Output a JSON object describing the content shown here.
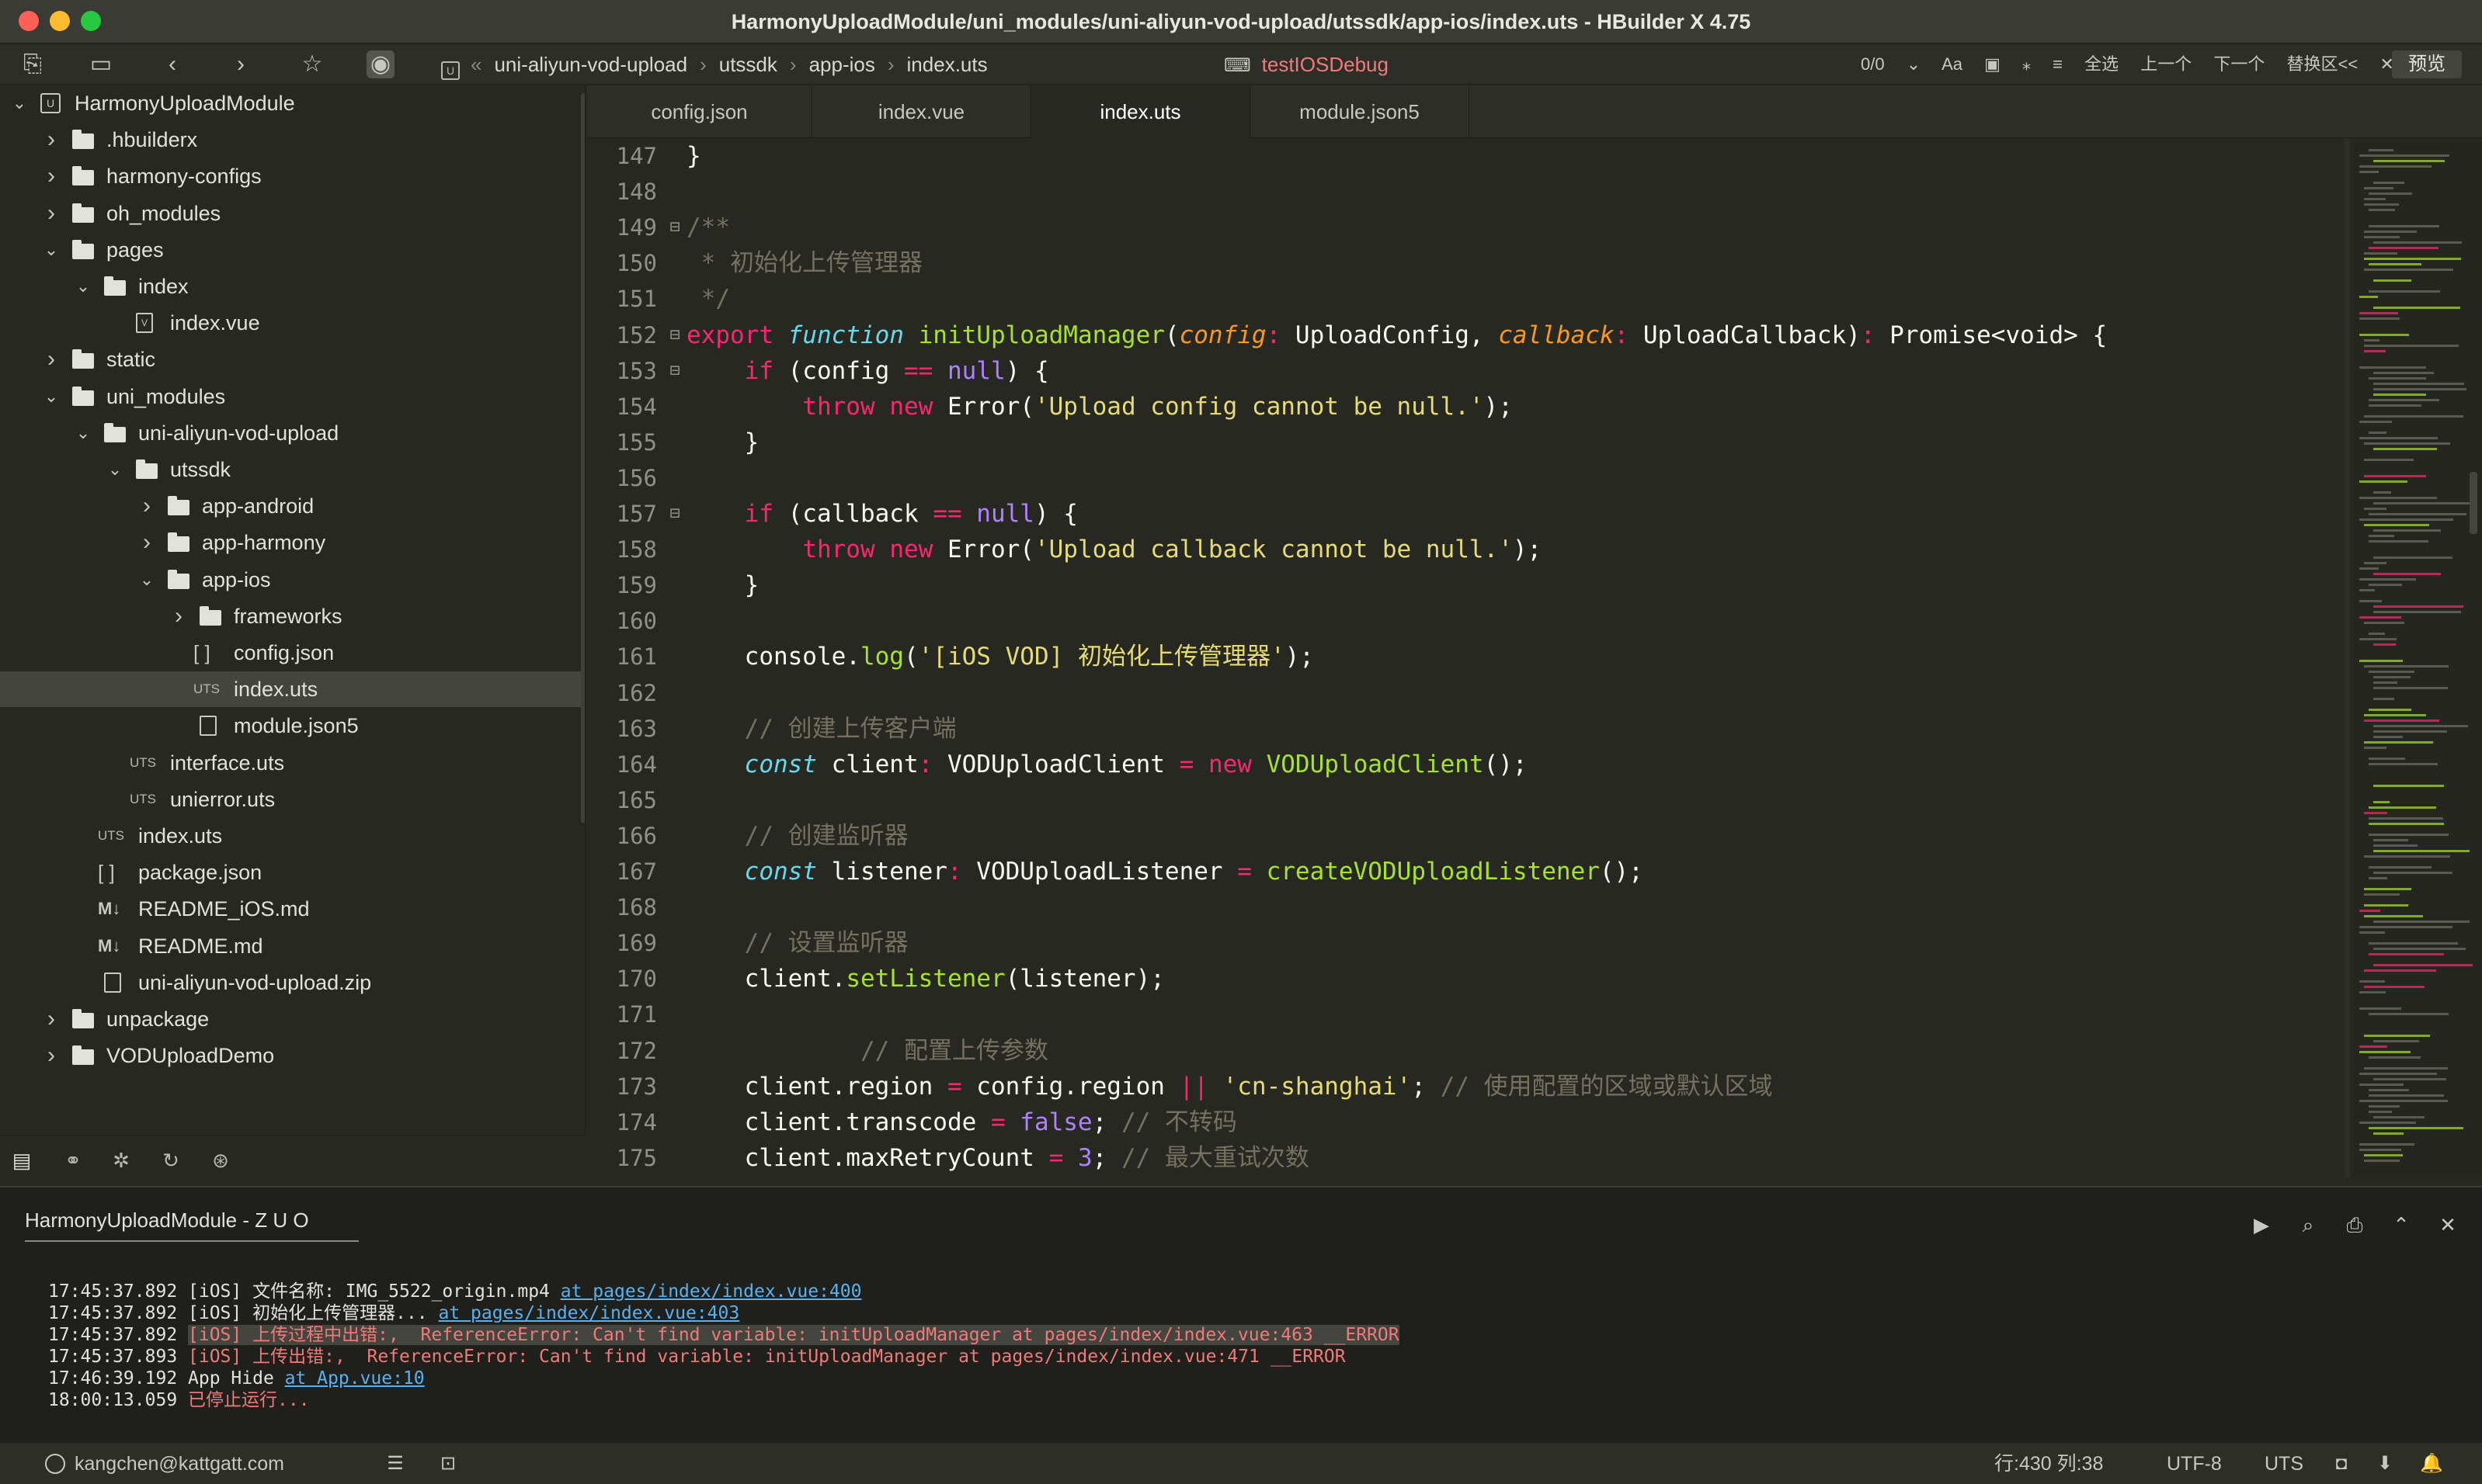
{
  "window": {
    "title": "HarmonyUploadModule/uni_modules/uni-aliyun-vod-upload/utssdk/app-ios/index.uts - HBuilder X 4.75"
  },
  "toolbar": {
    "breadcrumb": [
      "uni-aliyun-vod-upload",
      "utssdk",
      "app-ios",
      "index.uts"
    ],
    "run_config": "testIOSDebug",
    "find": {
      "count": "0/0",
      "case_label": "Aa",
      "select_all": "全选",
      "prev": "上一个",
      "next": "下一个",
      "replace": "替换区<<"
    },
    "preview_label": "预览"
  },
  "tree": [
    {
      "label": "HarmonyUploadModule",
      "type": "project",
      "expanded": true
    },
    {
      "label": ".hbuilderx",
      "type": "folder"
    },
    {
      "label": "harmony-configs",
      "type": "folder"
    },
    {
      "label": "oh_modules",
      "type": "folder"
    },
    {
      "label": "pages",
      "type": "folder",
      "expanded": true
    },
    {
      "label": "index",
      "type": "folder",
      "expanded": true
    },
    {
      "label": "index.vue",
      "type": "vue"
    },
    {
      "label": "static",
      "type": "folder"
    },
    {
      "label": "uni_modules",
      "type": "folder",
      "expanded": true
    },
    {
      "label": "uni-aliyun-vod-upload",
      "type": "folder",
      "expanded": true
    },
    {
      "label": "utssdk",
      "type": "folder",
      "expanded": true
    },
    {
      "label": "app-android",
      "type": "folder"
    },
    {
      "label": "app-harmony",
      "type": "folder"
    },
    {
      "label": "app-ios",
      "type": "folder",
      "expanded": true
    },
    {
      "label": "frameworks",
      "type": "folder"
    },
    {
      "label": "config.json",
      "type": "json"
    },
    {
      "label": "index.uts",
      "type": "uts",
      "selected": true
    },
    {
      "label": "module.json5",
      "type": "file"
    },
    {
      "label": "interface.uts",
      "type": "uts"
    },
    {
      "label": "unierror.uts",
      "type": "uts"
    },
    {
      "label": "index.uts",
      "type": "uts"
    },
    {
      "label": "package.json",
      "type": "json"
    },
    {
      "label": "README_iOS.md",
      "type": "md"
    },
    {
      "label": "README.md",
      "type": "md"
    },
    {
      "label": "uni-aliyun-vod-upload.zip",
      "type": "file"
    },
    {
      "label": "unpackage",
      "type": "folder"
    },
    {
      "label": "VODUploadDemo",
      "type": "folder"
    }
  ],
  "icon_labels": {
    "uts": "UTS",
    "json": "[ ]",
    "md": "M↓"
  },
  "tabs": [
    {
      "label": "config.json"
    },
    {
      "label": "index.vue"
    },
    {
      "label": "index.uts",
      "active": true
    },
    {
      "label": "module.json5"
    }
  ],
  "code": {
    "lines": [
      {
        "n": "147",
        "t": [
          [
            "p",
            "}"
          ]
        ]
      },
      {
        "n": "148",
        "t": []
      },
      {
        "n": "149",
        "fold": true,
        "t": [
          [
            "c",
            "/**"
          ]
        ]
      },
      {
        "n": "150",
        "t": [
          [
            "c",
            " * 初始化上传管理器"
          ]
        ]
      },
      {
        "n": "151",
        "t": [
          [
            "c",
            " */"
          ]
        ]
      },
      {
        "n": "152",
        "fold": true,
        "t": [
          [
            "k",
            "export"
          ],
          [
            "p",
            " "
          ],
          [
            "k2",
            "function"
          ],
          [
            "p",
            " "
          ],
          [
            "f",
            "initUploadManager"
          ],
          [
            "p",
            "("
          ],
          [
            "a",
            "config"
          ],
          [
            "k",
            ":"
          ],
          [
            "p",
            " UploadConfig, "
          ],
          [
            "a",
            "callback"
          ],
          [
            "k",
            ":"
          ],
          [
            "p",
            " UploadCallback)"
          ],
          [
            "k",
            ":"
          ],
          [
            "p",
            " Promise<void> {"
          ]
        ]
      },
      {
        "n": "153",
        "fold": true,
        "t": [
          [
            "p",
            "    "
          ],
          [
            "k",
            "if"
          ],
          [
            "p",
            " (config "
          ],
          [
            "k",
            "=="
          ],
          [
            "p",
            " "
          ],
          [
            "num",
            "null"
          ],
          [
            "p",
            ") {"
          ]
        ]
      },
      {
        "n": "154",
        "t": [
          [
            "p",
            "        "
          ],
          [
            "k",
            "throw"
          ],
          [
            "p",
            " "
          ],
          [
            "k",
            "new"
          ],
          [
            "p",
            " Error("
          ],
          [
            "s",
            "'Upload config cannot be null.'"
          ],
          [
            "p",
            ");"
          ]
        ]
      },
      {
        "n": "155",
        "t": [
          [
            "p",
            "    }"
          ]
        ]
      },
      {
        "n": "156",
        "t": []
      },
      {
        "n": "157",
        "fold": true,
        "t": [
          [
            "p",
            "    "
          ],
          [
            "k",
            "if"
          ],
          [
            "p",
            " (callback "
          ],
          [
            "k",
            "=="
          ],
          [
            "p",
            " "
          ],
          [
            "num",
            "null"
          ],
          [
            "p",
            ") {"
          ]
        ]
      },
      {
        "n": "158",
        "t": [
          [
            "p",
            "        "
          ],
          [
            "k",
            "throw"
          ],
          [
            "p",
            " "
          ],
          [
            "k",
            "new"
          ],
          [
            "p",
            " Error("
          ],
          [
            "s",
            "'Upload callback cannot be null.'"
          ],
          [
            "p",
            ");"
          ]
        ]
      },
      {
        "n": "159",
        "t": [
          [
            "p",
            "    }"
          ]
        ]
      },
      {
        "n": "160",
        "t": []
      },
      {
        "n": "161",
        "t": [
          [
            "p",
            "    console."
          ],
          [
            "f",
            "log"
          ],
          [
            "p",
            "("
          ],
          [
            "s",
            "'[iOS VOD] 初始化上传管理器'"
          ],
          [
            "p",
            ");"
          ]
        ]
      },
      {
        "n": "162",
        "t": []
      },
      {
        "n": "163",
        "t": [
          [
            "p",
            "    "
          ],
          [
            "c",
            "// 创建上传客户端"
          ]
        ]
      },
      {
        "n": "164",
        "t": [
          [
            "p",
            "    "
          ],
          [
            "k2",
            "const"
          ],
          [
            "p",
            " client"
          ],
          [
            "k",
            ":"
          ],
          [
            "p",
            " VODUploadClient "
          ],
          [
            "k",
            "="
          ],
          [
            "p",
            " "
          ],
          [
            "k",
            "new"
          ],
          [
            "p",
            " "
          ],
          [
            "f",
            "VODUploadClient"
          ],
          [
            "p",
            "();"
          ]
        ]
      },
      {
        "n": "165",
        "t": []
      },
      {
        "n": "166",
        "t": [
          [
            "p",
            "    "
          ],
          [
            "c",
            "// 创建监听器"
          ]
        ]
      },
      {
        "n": "167",
        "t": [
          [
            "p",
            "    "
          ],
          [
            "k2",
            "const"
          ],
          [
            "p",
            " listener"
          ],
          [
            "k",
            ":"
          ],
          [
            "p",
            " VODUploadListener "
          ],
          [
            "k",
            "="
          ],
          [
            "p",
            " "
          ],
          [
            "f",
            "createVODUploadListener"
          ],
          [
            "p",
            "();"
          ]
        ]
      },
      {
        "n": "168",
        "t": []
      },
      {
        "n": "169",
        "t": [
          [
            "p",
            "    "
          ],
          [
            "c",
            "// 设置监听器"
          ]
        ]
      },
      {
        "n": "170",
        "t": [
          [
            "p",
            "    client."
          ],
          [
            "f",
            "setListener"
          ],
          [
            "p",
            "(listener);"
          ]
        ]
      },
      {
        "n": "171",
        "t": []
      },
      {
        "n": "172",
        "t": [
          [
            "p",
            "            "
          ],
          [
            "c",
            "// 配置上传参数"
          ]
        ]
      },
      {
        "n": "173",
        "t": [
          [
            "p",
            "    client.region "
          ],
          [
            "k",
            "="
          ],
          [
            "p",
            " config.region "
          ],
          [
            "k",
            "||"
          ],
          [
            "p",
            " "
          ],
          [
            "s",
            "'cn-shanghai'"
          ],
          [
            "p",
            "; "
          ],
          [
            "c",
            "// 使用配置的区域或默认区域"
          ]
        ]
      },
      {
        "n": "174",
        "t": [
          [
            "p",
            "    client.transcode "
          ],
          [
            "k",
            "="
          ],
          [
            "p",
            " "
          ],
          [
            "num",
            "false"
          ],
          [
            "p",
            "; "
          ],
          [
            "c",
            "// 不转码"
          ]
        ]
      },
      {
        "n": "175",
        "t": [
          [
            "p",
            "    client.maxRetryCount "
          ],
          [
            "k",
            "="
          ],
          [
            "p",
            " "
          ],
          [
            "num",
            "3"
          ],
          [
            "p",
            "; "
          ],
          [
            "c",
            "// 最大重试次数"
          ]
        ]
      }
    ]
  },
  "console": {
    "tab_label": "HarmonyUploadModule - Z U O",
    "lines": [
      [
        [
          "t",
          "17:45:37.892 [iOS] 文件名称: IMG_5522_origin.mp4 "
        ],
        [
          "l",
          "at pages/index/index.vue:400"
        ]
      ],
      [
        [
          "t",
          "17:45:37.892 [iOS] 初始化上传管理器... "
        ],
        [
          "l",
          "at pages/index/index.vue:403"
        ]
      ],
      [
        [
          "t",
          "17:45:37.892 "
        ],
        [
          "eh",
          "[iOS] 上传过程中出错:,  ReferenceError: Can't find variable: initUploadManager at pages/index/index.vue:463 __ERROR"
        ]
      ],
      [
        [
          "t",
          "17:45:37.893 "
        ],
        [
          "e",
          "[iOS] 上传出错:,  ReferenceError: Can't find variable: initUploadManager at pages/index/index.vue:471 __ERROR"
        ]
      ],
      [
        [
          "t",
          "17:46:39.192 App Hide "
        ],
        [
          "l",
          "at App.vue:10"
        ]
      ],
      [
        [
          "t",
          "18:00:13.059 "
        ],
        [
          "e",
          "已停止运行..."
        ]
      ]
    ]
  },
  "status": {
    "user": "kangchen@kattgatt.com",
    "position": "行:430  列:38",
    "encoding": "UTF-8",
    "language": "UTS"
  }
}
